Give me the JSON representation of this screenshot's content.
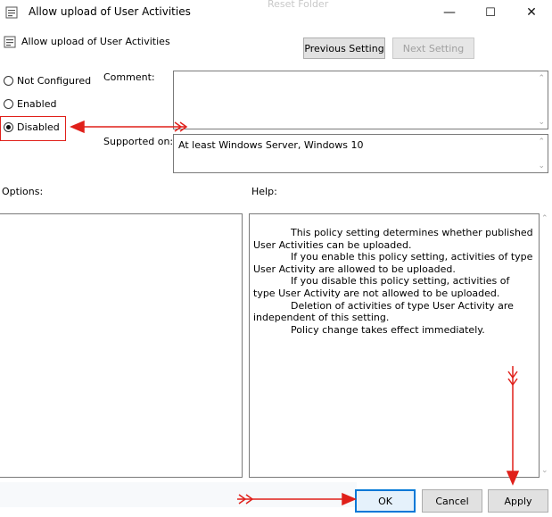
{
  "window": {
    "title": "Allow upload of User Activities",
    "ghost_title": "Reset Folder",
    "minimize_glyph": "—",
    "maximize_glyph": "☐",
    "close_glyph": "✕"
  },
  "header": {
    "title": "Allow upload of User Activities",
    "previous_label": "Previous Setting",
    "next_label": "Next Setting"
  },
  "state": {
    "options": [
      {
        "label": "Not Configured",
        "selected": false
      },
      {
        "label": "Enabled",
        "selected": false
      },
      {
        "label": "Disabled",
        "selected": true
      }
    ]
  },
  "fields": {
    "comment_label": "Comment:",
    "comment_value": "",
    "supported_label": "Supported on:",
    "supported_value": "At least Windows Server, Windows 10"
  },
  "panels": {
    "options_label": "Options:",
    "help_label": "Help:",
    "help_text": "            This policy setting determines whether published User Activities can be uploaded.\n            If you enable this policy setting, activities of type User Activity are allowed to be uploaded.\n            If you disable this policy setting, activities of type User Activity are not allowed to be uploaded.\n            Deletion of activities of type User Activity are independent of this setting.\n            Policy change takes effect immediately."
  },
  "footer": {
    "ok_label": "OK",
    "cancel_label": "Cancel",
    "apply_label": "Apply"
  },
  "colors": {
    "annotation": "#e0201a",
    "accent": "#0078d7"
  },
  "icons": {
    "app": "policy-icon",
    "scroll_up": "chevron-up-icon",
    "scroll_down": "chevron-down-icon"
  }
}
